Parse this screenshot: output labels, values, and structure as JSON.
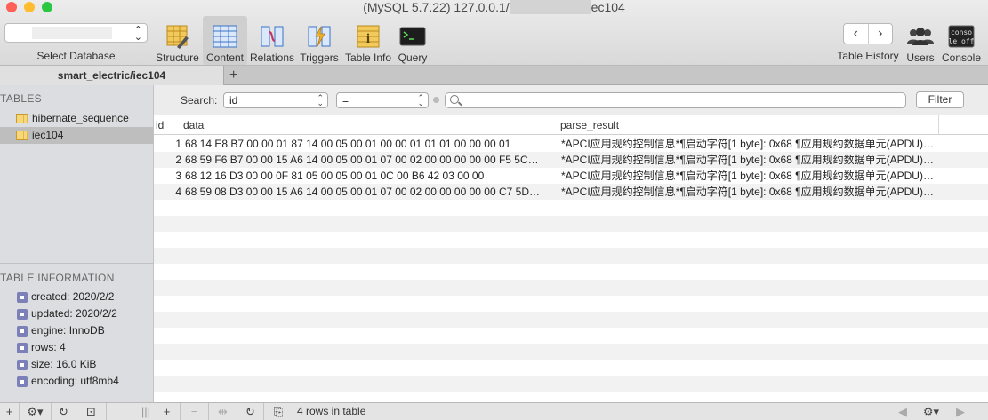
{
  "window": {
    "title_prefix": "(MySQL 5.7.22) 127.0.0.1/",
    "title_suffix": "ec104",
    "traffic_colors": {
      "close": "#fe5f57",
      "minimize": "#febc2e",
      "zoom": "#28c840"
    }
  },
  "toolbar": {
    "select_database_label": "Select Database",
    "items": [
      {
        "label": "Structure",
        "icon": "structure-icon"
      },
      {
        "label": "Content",
        "icon": "content-icon",
        "active": true
      },
      {
        "label": "Relations",
        "icon": "relations-icon"
      },
      {
        "label": "Triggers",
        "icon": "triggers-icon"
      },
      {
        "label": "Table Info",
        "icon": "table-info-icon"
      },
      {
        "label": "Query",
        "icon": "query-icon"
      }
    ],
    "right": [
      {
        "label": "Table History"
      },
      {
        "label": "Users"
      },
      {
        "label": "Console"
      }
    ],
    "console_icon_text": "conso le off"
  },
  "tabs": [
    {
      "label": "smart_electric/iec104"
    }
  ],
  "sidebar": {
    "tables_heading": "TABLES",
    "tables": [
      {
        "name": "hibernate_sequence",
        "selected": false
      },
      {
        "name": "iec104",
        "selected": true
      }
    ],
    "info_heading": "TABLE INFORMATION",
    "info": [
      "created: 2020/2/2",
      "updated: 2020/2/2",
      "engine: InnoDB",
      "rows: 4",
      "size: 16.0 KiB",
      "encoding: utf8mb4"
    ]
  },
  "filter": {
    "label": "Search:",
    "field": "id",
    "operator": "=",
    "value": "",
    "button": "Filter"
  },
  "grid": {
    "columns": [
      "id",
      "data",
      "parse_result"
    ],
    "rows": [
      {
        "id": "1",
        "data": "68 14 E8 B7 00 00 01 87 14 00 05 00 01 00 00 01 01 01 00 00 00 01",
        "parse_result": "*APCI应用规约控制信息*¶启动字符[1 byte]: 0x68 ¶应用规约数据单元(APDU)长度…"
      },
      {
        "id": "2",
        "data": "68 59 F6 B7 00 00 15 A6 14 00 05 00 01 07 00 02 00 00 00 00 00 F5 5C…",
        "parse_result": "*APCI应用规约控制信息*¶启动字符[1 byte]: 0x68 ¶应用规约数据单元(APDU)长度…"
      },
      {
        "id": "3",
        "data": "68 12 16 D3 00 00 0F 81 05 00 05 00 01 0C 00 B6 42 03 00 00",
        "parse_result": "*APCI应用规约控制信息*¶启动字符[1 byte]: 0x68 ¶应用规约数据单元(APDU)长度…"
      },
      {
        "id": "4",
        "data": "68 59 08 D3 00 00 15 A6 14 00 05 00 01 07 00 02 00 00 00 00 00 C7 5D…",
        "parse_result": "*APCI应用规约控制信息*¶启动字符[1 byte]: 0x68 ¶应用规约数据单元(APDU)长度…"
      }
    ],
    "empty_rows": 12
  },
  "status": {
    "row_count": "4 rows in table"
  }
}
